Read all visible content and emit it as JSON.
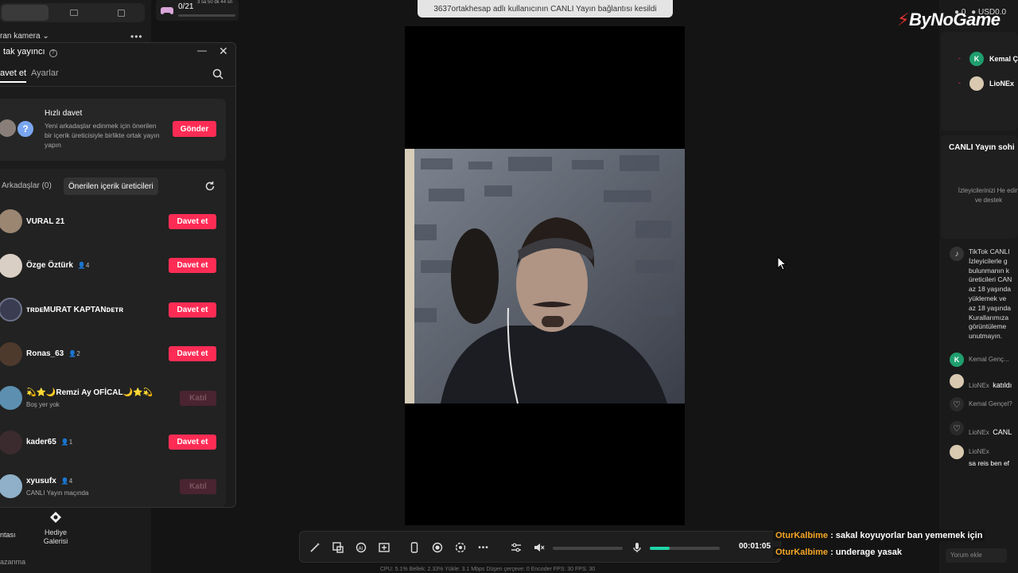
{
  "top_left": {
    "camera_label": "ran kamera"
  },
  "progress": {
    "count": "0/21",
    "time": "3 sa 50 dk 44 sn",
    "fill": 0
  },
  "panel": {
    "title": "tak yayıncı",
    "tabs": [
      "avet et",
      "Ayarlar"
    ],
    "quick_invite": {
      "title": "Hızlı davet",
      "description": "Yeni arkadaşlar edinmek için önerilen bir içerik üreticisiyle birlikte ortak yayın yapın",
      "button": "Gönder"
    },
    "filters": [
      "Arkadaşlar (0)",
      "Önerilen içerik üreticileri"
    ],
    "users": [
      {
        "name": "VURAL 21",
        "count": "",
        "sub": "",
        "button": "Davet et",
        "enabled": true
      },
      {
        "name": "Özge Öztürk",
        "count": "4",
        "sub": "",
        "button": "Davet et",
        "enabled": true
      },
      {
        "name": "ᴛʀᴅᴇMURAT KAPTANᴅᴇᴛʀ",
        "count": "",
        "sub": "",
        "button": "Davet et",
        "enabled": true
      },
      {
        "name": "Ronas_63",
        "count": "2",
        "sub": "",
        "button": "Davet et",
        "enabled": true
      },
      {
        "name": "💫⭐🌙Remzi Ay OFİCAL🌙⭐💫",
        "count": "",
        "sub": "Boş yer yok",
        "button": "Katıl",
        "enabled": false
      },
      {
        "name": "kader65",
        "count": "1",
        "sub": "",
        "button": "Davet et",
        "enabled": true
      },
      {
        "name": "xyusufx",
        "count": "4",
        "sub": "CANLI Yayın maçında",
        "button": "Katıl",
        "enabled": false
      }
    ]
  },
  "bottom_left": {
    "left_label": "ntası",
    "gift_label": "Hediye Galerisi",
    "footer": "azanma"
  },
  "banner": "3637ortakhesap adlı kullanıcının CANLI Yayın bağlantısı kesildi",
  "toolbar": {
    "timer": "00:01:05",
    "volume_level": 0,
    "mic_level": 0.28
  },
  "status_bar": "CPU: 5.1%  Bellek: 2.33%  Yükle: 3.1 Mbps  Düşen çerçeve: 0  Encoder FPS: 30  FPS: 30",
  "logo": "ByNoGame",
  "hud": {
    "stat1": "0",
    "stat2": "USD0.0"
  },
  "right_top": [
    {
      "initial": "K",
      "name": "Kemal Ç",
      "color": "#1f9e6e"
    },
    {
      "initial": "",
      "name": "LioNEx",
      "color": "#d8c9b0"
    }
  ],
  "chat": {
    "title": "CANLI Yayın sohi",
    "empty_text": "İzleyicilerinizi He edin ve destek",
    "tiktok_notice": [
      "TikTok CANLI",
      "İzleyicilerle g",
      "bulunmanın k",
      "üreticileri CAN",
      "az 18 yaşında",
      "yüklemek ve",
      "az 18 yaşında",
      "Kurallarımıza",
      "görüntüleme",
      "unutmayın."
    ],
    "messages": [
      {
        "avatar": "K",
        "user": "Kemal Genç...",
        "text": ""
      },
      {
        "avatar": "",
        "user": "LioNEx",
        "text": "katıldı"
      },
      {
        "avatar": "♡",
        "user": "Kemal Gençel?",
        "text": ""
      },
      {
        "avatar": "♡",
        "user": "LioNEx",
        "text": "CANL"
      },
      {
        "avatar": "",
        "user": "LioNEx",
        "text": "sa reis ben ef"
      }
    ],
    "comment_placeholder": "Yorum ekle"
  },
  "overlay_chat": [
    {
      "name": "OturKalbime",
      "text": ": sakal koyuyorlar ban yememek için"
    },
    {
      "name": "OturKalbime",
      "text": ": underage yasak"
    }
  ]
}
